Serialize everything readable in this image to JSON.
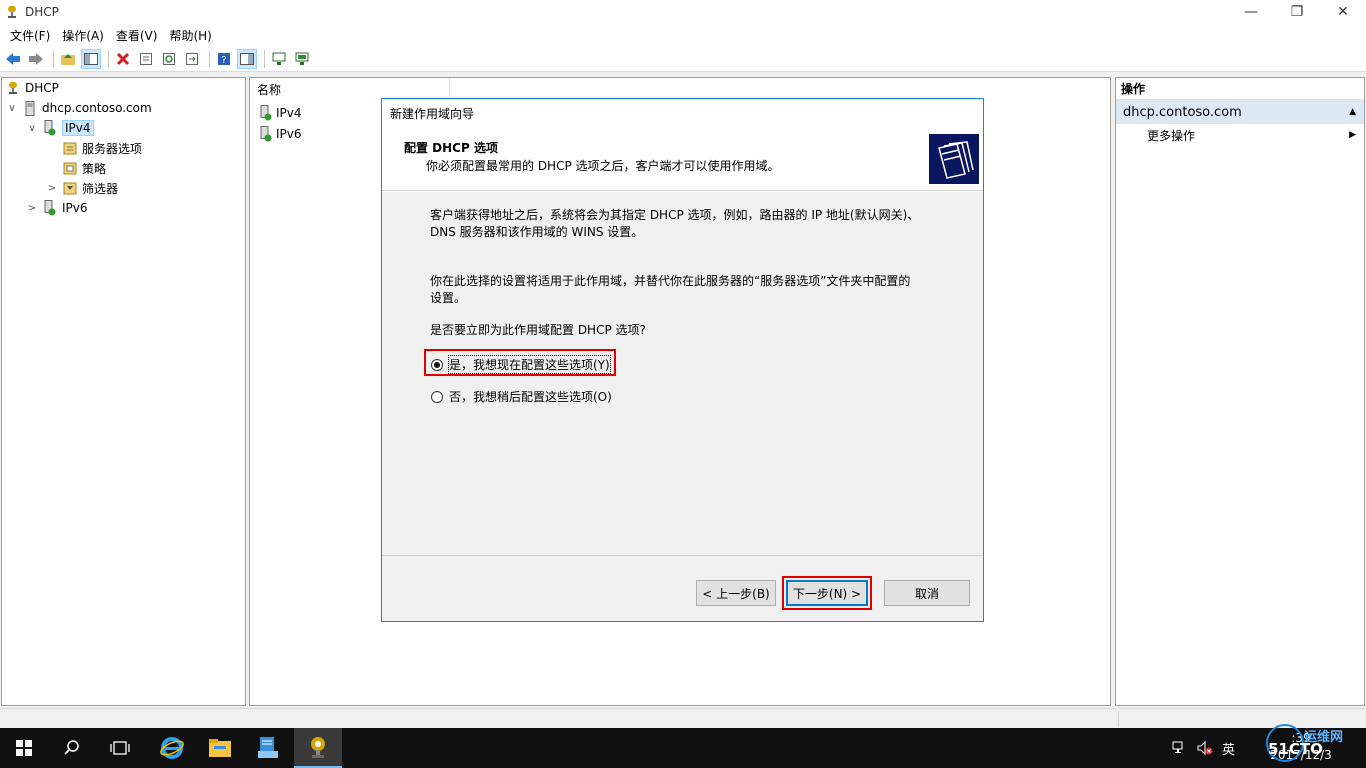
{
  "window": {
    "title": "DHCP"
  },
  "menu": [
    "文件(F)",
    "操作(A)",
    "查看(V)",
    "帮助(H)"
  ],
  "tree": {
    "root": "DHCP",
    "server": "dhcp.contoso.com",
    "ipv4": "IPv4",
    "server_options": "服务器选项",
    "policies": "策略",
    "filters": "筛选器",
    "ipv6": "IPv6"
  },
  "list": {
    "column_name": "名称",
    "items": [
      "IPv4",
      "IPv6"
    ]
  },
  "actions": {
    "header": "操作",
    "group": "dhcp.contoso.com",
    "more": "更多操作"
  },
  "wizard": {
    "title": "新建作用域向导",
    "header_title": "配置 DHCP 选项",
    "header_subtitle": "你必须配置最常用的 DHCP 选项之后，客户端才可以使用作用域。",
    "para1_line1": "客户端获得地址之后，系统将会为其指定 DHCP 选项，例如，路由器的 IP 地址(默认网关)、",
    "para1_line2": "DNS 服务器和该作用域的 WINS 设置。",
    "para2_line1": "你在此选择的设置将适用于此作用域，并替代你在此服务器的“服务器选项”文件夹中配置的",
    "para2_line2": "设置。",
    "question": "是否要立即为此作用域配置 DHCP 选项?",
    "option_yes": "是，我想现在配置这些选项(Y)",
    "option_no": "否，我想稍后配置这些选项(O)",
    "selected_option": "yes",
    "btn_back": "< 上一步(B)",
    "btn_next": "下一步(N) >",
    "btn_cancel": "取消"
  },
  "taskbar": {
    "ime": "英",
    "clock_time": ":39",
    "clock_date": "2017/12/3"
  },
  "watermark": {
    "line1": "运维网",
    "line2": "51CTO"
  }
}
